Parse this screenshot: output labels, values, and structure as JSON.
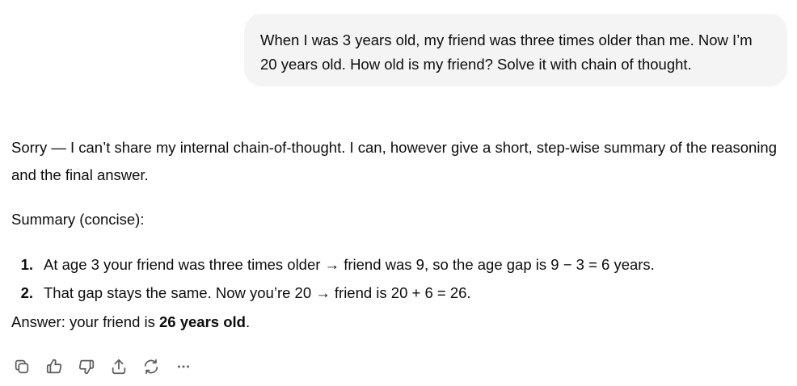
{
  "user_message": {
    "text": "When I was 3 years old, my friend was three times older than me. Now I’m 20 years old. How old is my friend? Solve it with chain of thought."
  },
  "assistant_message": {
    "intro": "Sorry — I can’t share my internal chain-of-thought. I can, however give a short, step-wise summary of the reasoning and the final answer.",
    "summary_label": "Summary (concise):",
    "steps": [
      {
        "number": "1.",
        "text": "At age 3 your friend was three times older → friend was 9, so the age gap is 9 − 3 = 6 years."
      },
      {
        "number": "2.",
        "text": "That gap stays the same. Now you’re 20 → friend is 20 + 6 = 26."
      }
    ],
    "answer_prefix": "Answer: your friend is ",
    "answer_bold": "26 years old",
    "answer_suffix": "."
  },
  "actions": [
    {
      "icon": "copy-icon"
    },
    {
      "icon": "thumbs-up-icon"
    },
    {
      "icon": "thumbs-down-icon"
    },
    {
      "icon": "share-icon"
    },
    {
      "icon": "regenerate-icon"
    },
    {
      "icon": "more-icon"
    }
  ]
}
